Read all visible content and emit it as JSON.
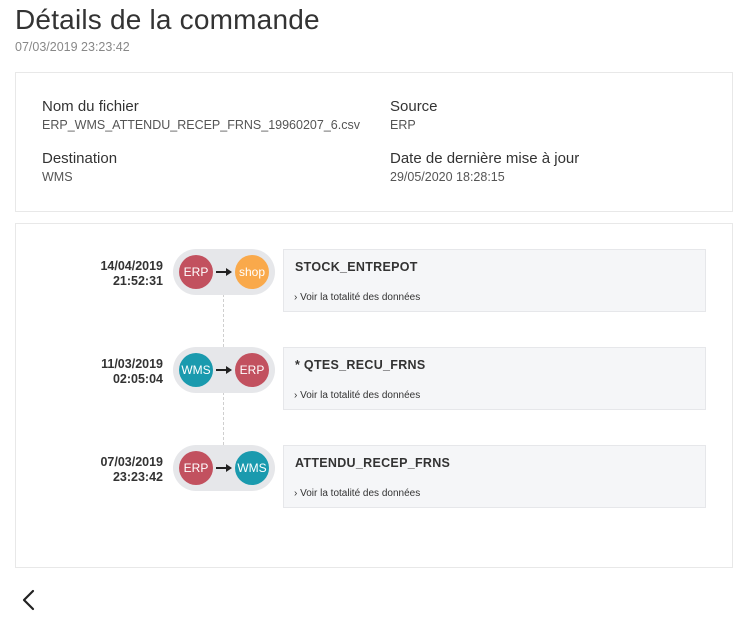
{
  "header": {
    "title": "Détails de la commande",
    "timestamp": "07/03/2019 23:23:42"
  },
  "info": {
    "file_label": "Nom du fichier",
    "file_value": "ERP_WMS_ATTENDU_RECEP_FRNS_19960207_6.csv",
    "source_label": "Source",
    "source_value": "ERP",
    "destination_label": "Destination",
    "destination_value": "WMS",
    "updated_label": "Date de dernière mise à jour",
    "updated_value": "29/05/2020 18:28:15"
  },
  "events": [
    {
      "date": "14/04/2019",
      "time": "21:52:31",
      "from": "ERP",
      "to": "shop",
      "title": "STOCK_ENTREPOT",
      "link": "› Voir la totalité des données"
    },
    {
      "date": "11/03/2019",
      "time": "02:05:04",
      "from": "WMS",
      "to": "ERP",
      "title": "* QTES_RECU_FRNS",
      "link": "› Voir la totalité des données"
    },
    {
      "date": "07/03/2019",
      "time": "23:23:42",
      "from": "ERP",
      "to": "WMS",
      "title": "ATTENDU_RECEP_FRNS",
      "link": "› Voir la totalité des données"
    }
  ],
  "icons": {
    "arrow": "arrow-right-icon",
    "back": "chevron-left-icon"
  },
  "colors": {
    "erp": "#c2515f",
    "wms": "#1a9aae",
    "shop": "#f9a94b",
    "pill_bg": "#e6e7ea",
    "card_bg": "#f5f6f8"
  }
}
